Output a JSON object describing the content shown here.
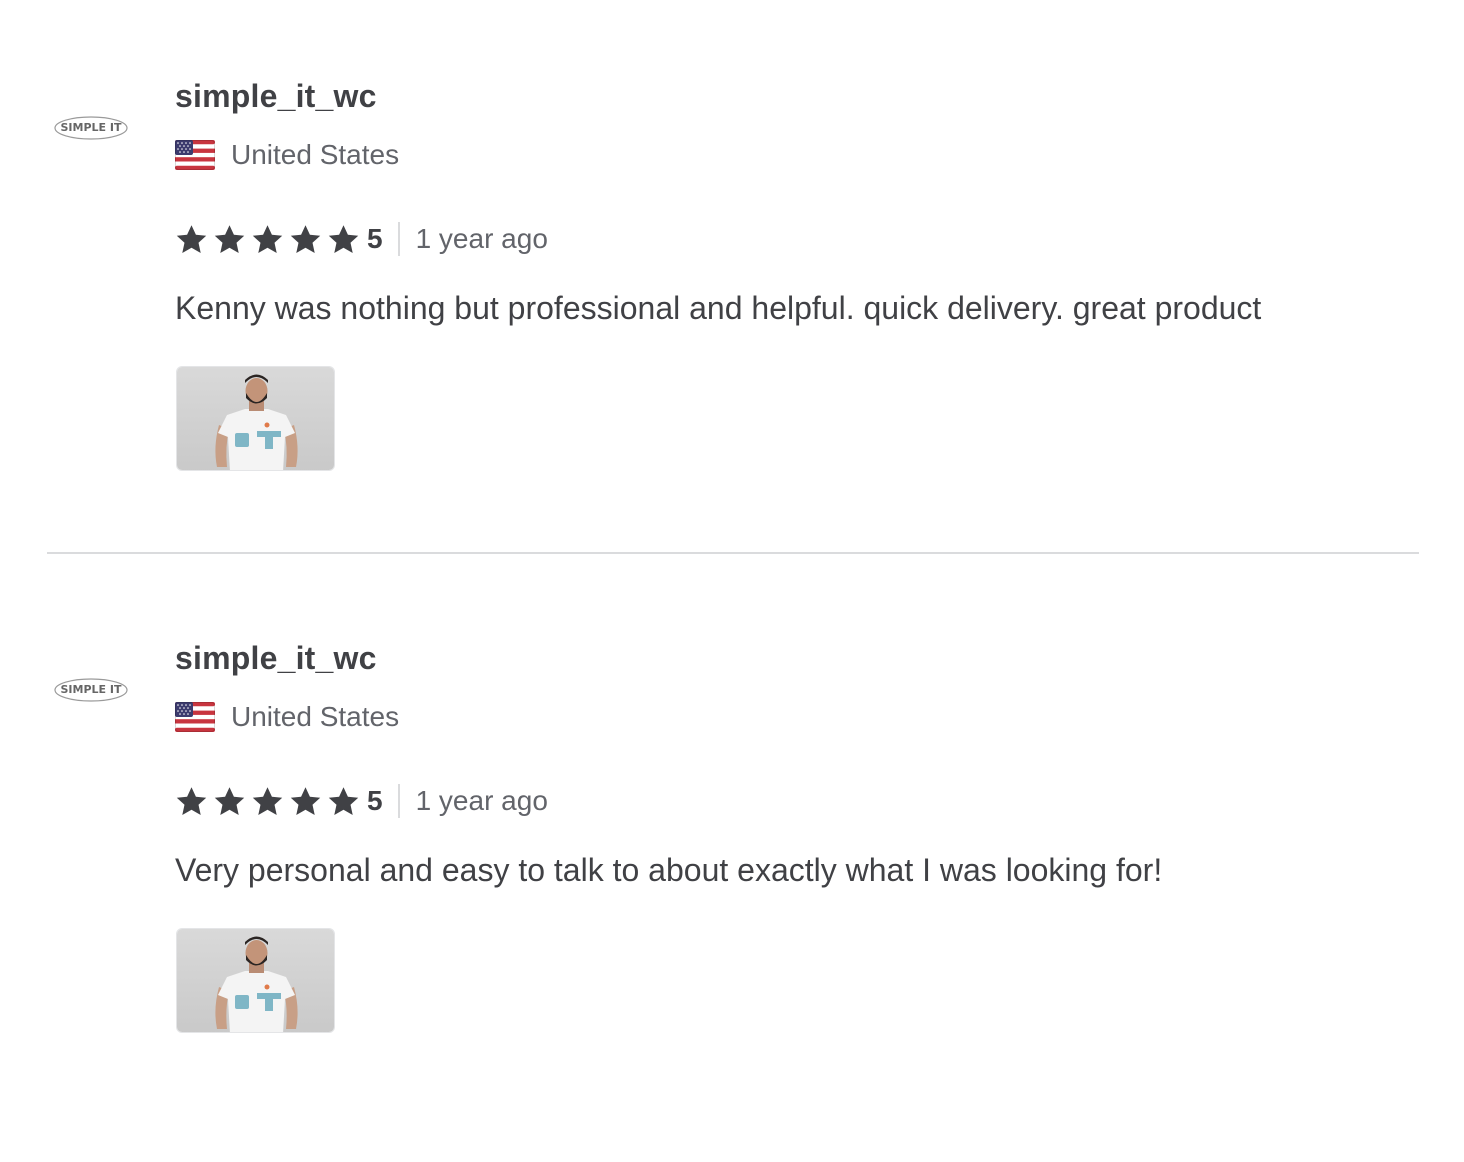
{
  "reviews": [
    {
      "username": "simple_it_wc",
      "avatar_text": "SIMPLE IT",
      "country": "United States",
      "flag_icon": "us-flag-icon",
      "rating": "5",
      "stars_filled": 5,
      "time": "1 year ago",
      "text": "Kenny was nothing but professional and helpful. quick delivery. great product",
      "attachment": "t-shirt-photo"
    },
    {
      "username": "simple_it_wc",
      "avatar_text": "SIMPLE IT",
      "country": "United States",
      "flag_icon": "us-flag-icon",
      "rating": "5",
      "stars_filled": 5,
      "time": "1 year ago",
      "text": "Very personal and easy to talk to about exactly what I was looking for!",
      "attachment": "t-shirt-photo"
    }
  ],
  "colors": {
    "text_primary": "#404145",
    "text_secondary": "#62646a",
    "star": "#404145",
    "divider": "#dadbdd"
  }
}
